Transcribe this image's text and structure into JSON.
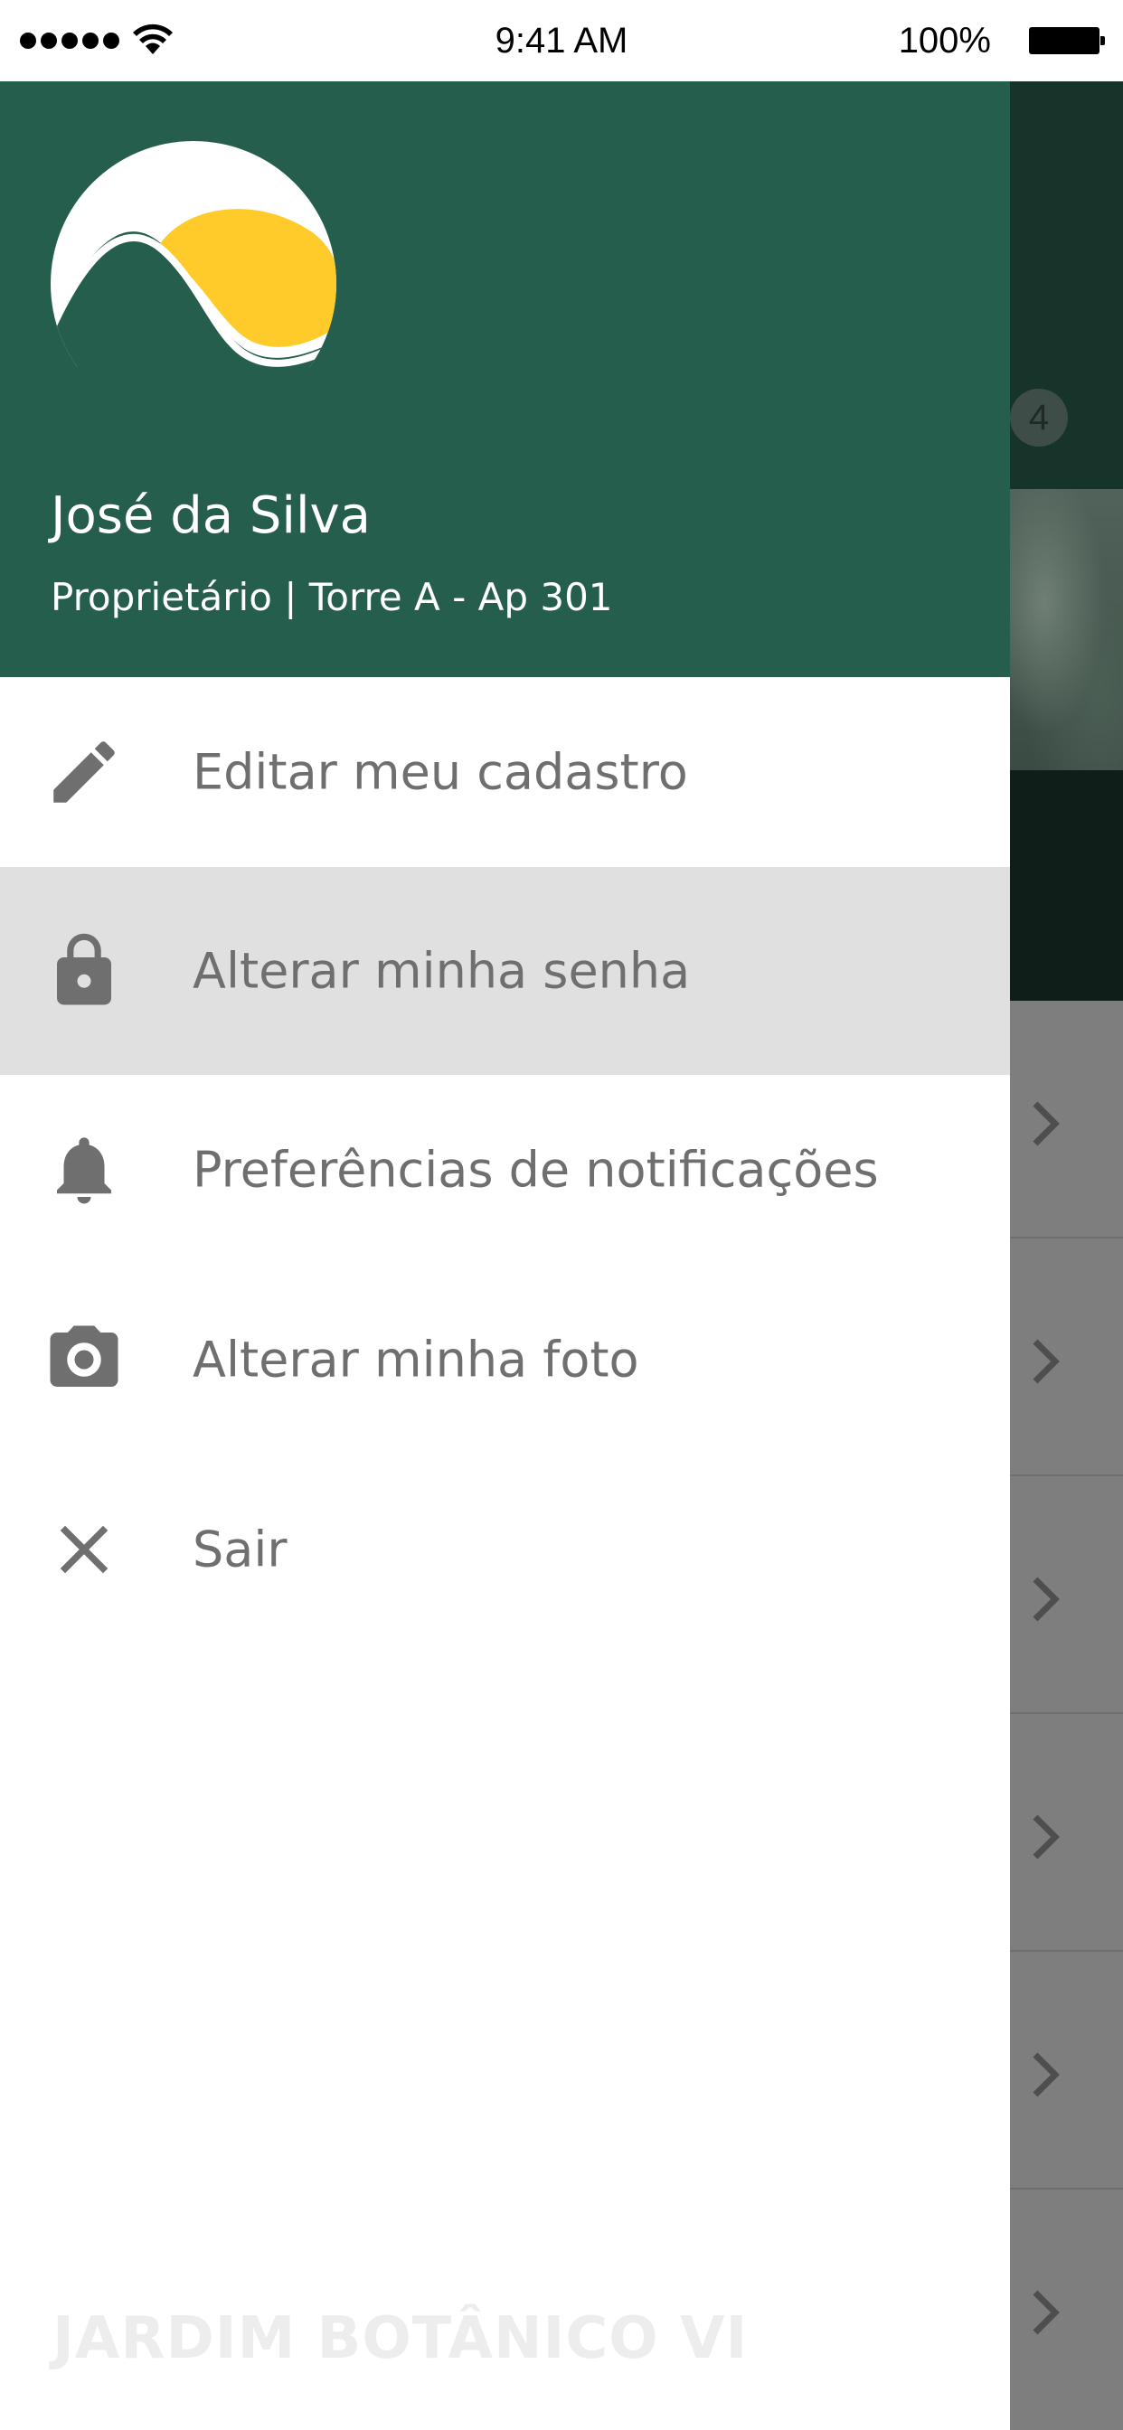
{
  "status_bar": {
    "time": "9:41 AM",
    "battery_percent": "100%",
    "signal_bars": 5
  },
  "drawer": {
    "user": {
      "name": "José da Silva",
      "subtitle": "Proprietário | Torre A - Ap 301"
    },
    "menu": [
      {
        "icon": "pencil-icon",
        "label": "Editar meu cadastro",
        "active": false
      },
      {
        "icon": "lock-icon",
        "label": "Alterar minha senha",
        "active": true
      },
      {
        "icon": "bell-icon",
        "label": "Preferências de notificações",
        "active": false
      },
      {
        "icon": "camera-icon",
        "label": "Alterar minha foto",
        "active": false
      },
      {
        "icon": "close-icon",
        "label": "Sair",
        "active": false
      }
    ],
    "footer_brand": "JARDIM BOTÂNICO VI"
  },
  "background": {
    "badge_count": "4",
    "rows": 6
  },
  "colors": {
    "header_green": "#265e4e",
    "logo_yellow": "#fecb2b",
    "menu_text": "#6f6f6f",
    "active_row": "#e0e0e0"
  }
}
